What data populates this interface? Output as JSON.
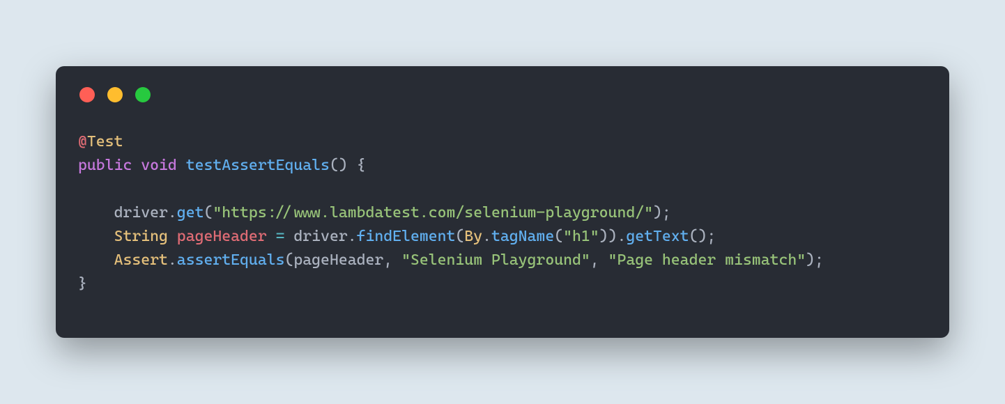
{
  "window": {
    "traffic_lights": {
      "red": "#ff5f56",
      "yellow": "#ffbd2e",
      "green": "#27c93f"
    }
  },
  "code": {
    "line1": {
      "at": "@",
      "annotation": "Test"
    },
    "line2": {
      "kw_public": "public",
      "kw_void": "void",
      "method_name": "testAssertEquals",
      "parens_open": "()",
      "brace_open": " {"
    },
    "line4": {
      "indent": "    ",
      "obj": "driver",
      "dot": ".",
      "call": "get",
      "paren_open": "(",
      "arg_str": "\"https://www.lambdatest.com/selenium-playground/\"",
      "paren_close": ");"
    },
    "line5": {
      "indent": "    ",
      "type": "String",
      "var": "pageHeader",
      "eq": " = ",
      "obj": "driver",
      "dot1": ".",
      "call1": "findElement",
      "paren_open1": "(",
      "by_class": "By",
      "dot2": ".",
      "call2": "tagName",
      "paren_open2": "(",
      "arg_str": "\"h1\"",
      "paren_close2": "))",
      "dot3": ".",
      "call3": "getText",
      "paren_close3": "();"
    },
    "line6": {
      "indent": "    ",
      "cls": "Assert",
      "dot": ".",
      "call": "assertEquals",
      "paren_open": "(",
      "arg1": "pageHeader",
      "comma1": ", ",
      "arg2": "\"Selenium Playground\"",
      "comma2": ", ",
      "arg3": "\"Page header mismatch\"",
      "paren_close": ");"
    },
    "line7": {
      "brace_close": "}"
    }
  }
}
